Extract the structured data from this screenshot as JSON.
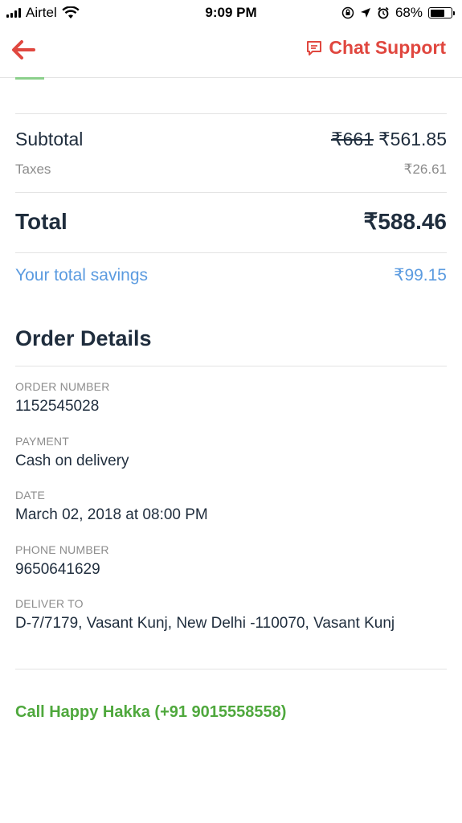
{
  "status_bar": {
    "carrier": "Airtel",
    "time": "9:09 PM",
    "battery": "68%",
    "battery_level": 0.68,
    "icons": [
      "signal-icon",
      "wifi-icon",
      "rotation-lock-icon",
      "location-icon",
      "alarm-icon",
      "battery-icon"
    ]
  },
  "header": {
    "back_icon": "back-arrow-icon",
    "chat_icon": "chat-icon",
    "chat_support": "Chat Support",
    "accent_color": "#e0473f"
  },
  "summary": {
    "subtotal_label": "Subtotal",
    "subtotal_original": "₹661",
    "subtotal_value": "₹561.85",
    "taxes_label": "Taxes",
    "taxes_value": "₹26.61",
    "total_label": "Total",
    "total_value": "₹588.46",
    "savings_label": "Your total savings",
    "savings_value": "₹99.15",
    "savings_color": "#5b9be0"
  },
  "order_details": {
    "title": "Order Details",
    "fields": [
      {
        "label": "ORDER NUMBER",
        "value": "1152545028"
      },
      {
        "label": "PAYMENT",
        "value": "Cash on delivery"
      },
      {
        "label": "DATE",
        "value": "March 02, 2018 at 08:00 PM"
      },
      {
        "label": "PHONE NUMBER",
        "value": "9650641629"
      },
      {
        "label": "DELIVER TO",
        "value": "D-7/7179, Vasant Kunj, New Delhi -110070, Vasant Kunj"
      }
    ]
  },
  "call": {
    "label": "Call Happy Hakka (+91 9015558558)",
    "color": "#4fa83d"
  }
}
